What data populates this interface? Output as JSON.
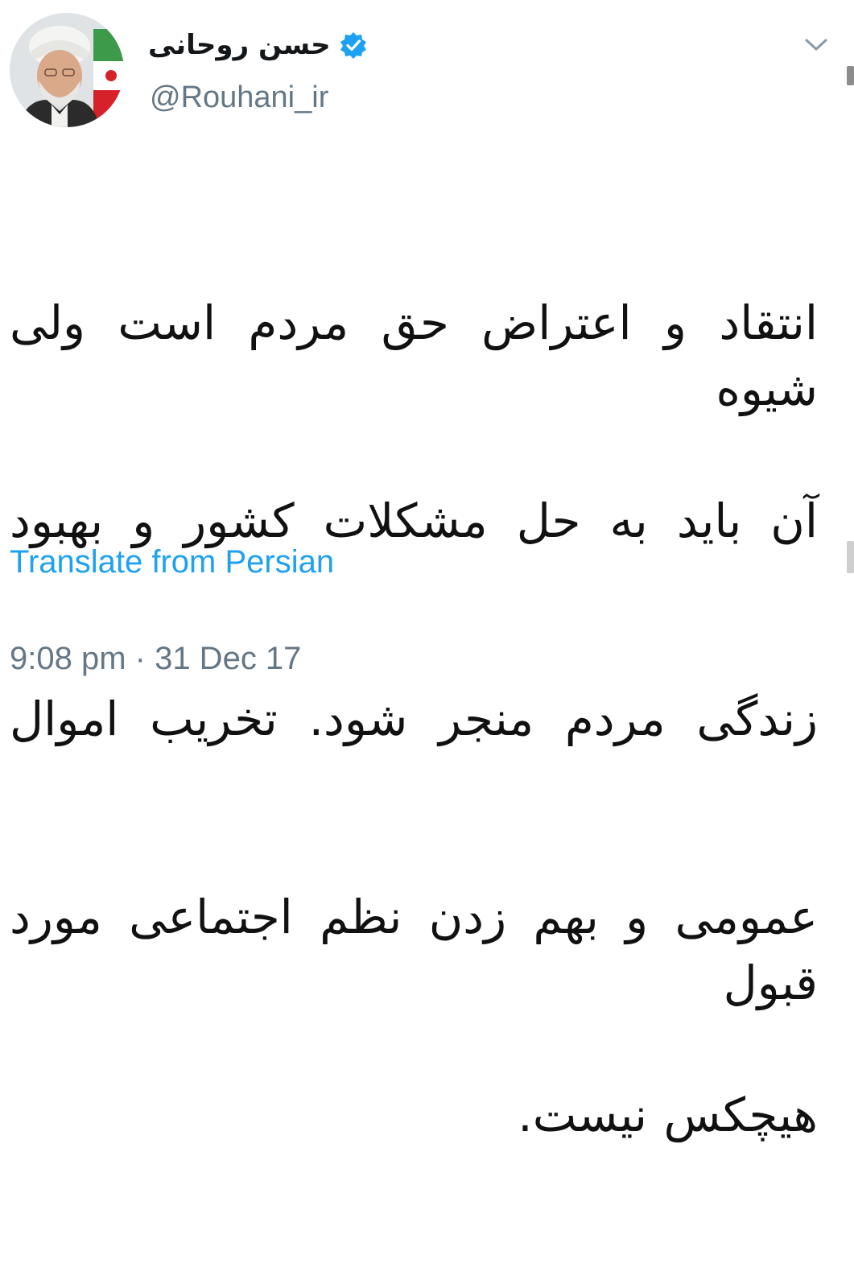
{
  "tweet": {
    "author": {
      "display_name": "حسن روحانی",
      "handle": "@Rouhani_ir",
      "verified_icon": "verified-badge-icon",
      "avatar_icon": "avatar-portrait"
    },
    "menu_icon": "chevron-down-icon",
    "text_lines": [
      "انتقاد و اعتراض حق مردم است ولی شیوه",
      "آن باید به حل مشکلات کشور و بهبود",
      "زندگی مردم منجر شود. تخریب اموال",
      "عمومی و بهم زدن نظم اجتماعی مورد قبول",
      "هیچکس نیست."
    ],
    "translate_label": "Translate from Persian",
    "timestamp": "9:08 pm · 31 Dec 17"
  },
  "colors": {
    "link_blue": "#1da1f2",
    "muted_gray": "#657786",
    "verified_blue": "#1da1f2"
  }
}
